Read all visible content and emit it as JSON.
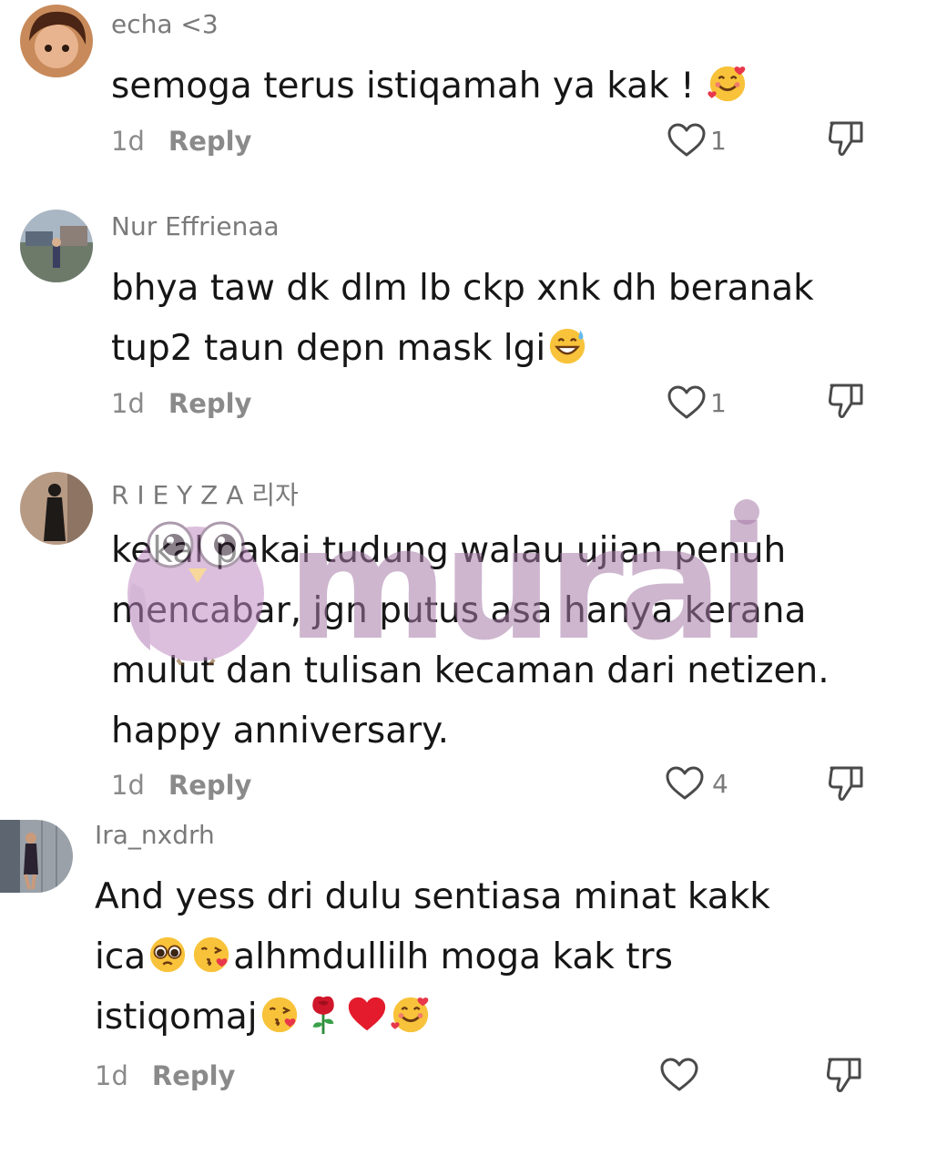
{
  "comments": [
    {
      "username": "echa <3",
      "text_parts": [
        "semoga terus istiqamah ya kak ! "
      ],
      "emoji_after": [
        "smiling-face-with-hearts"
      ],
      "time": "1d",
      "reply_label": "Reply",
      "likes": "1"
    },
    {
      "username": "Nur Effrienaa",
      "line1": "bhya taw dk dlm lb ckp xnk dh beranak",
      "line2": "tup2 taun depn mask lgi",
      "emoji_after": [
        "grinning-face-with-sweat"
      ],
      "time": "1d",
      "reply_label": "Reply",
      "likes": "1"
    },
    {
      "username": "R I E Y Z A 리자",
      "line1": "kekal pakai tudung walau ujian penuh",
      "line2": "mencabar, jgn putus asa hanya kerana",
      "line3": "mulut dan tulisan kecaman dari netizen.",
      "line4": "happy anniversary.",
      "time": "1d",
      "reply_label": "Reply",
      "likes": "4"
    },
    {
      "username": "Ira_nxdrh",
      "line1": "And yess dri dulu sentiasa minat kakk",
      "line2_a": "ica",
      "line2_b": "alhmdullilh moga kak trs",
      "line3": "istiqomaj",
      "time": "1d",
      "reply_label": "Reply",
      "likes": ""
    }
  ],
  "watermark": {
    "text": "murai"
  },
  "icons": {
    "like": "heart-outline-icon",
    "dislike": "thumbs-down-icon"
  },
  "colors": {
    "text": "#161616",
    "meta": "#8a8a8a",
    "watermark": "#a67aa8"
  }
}
